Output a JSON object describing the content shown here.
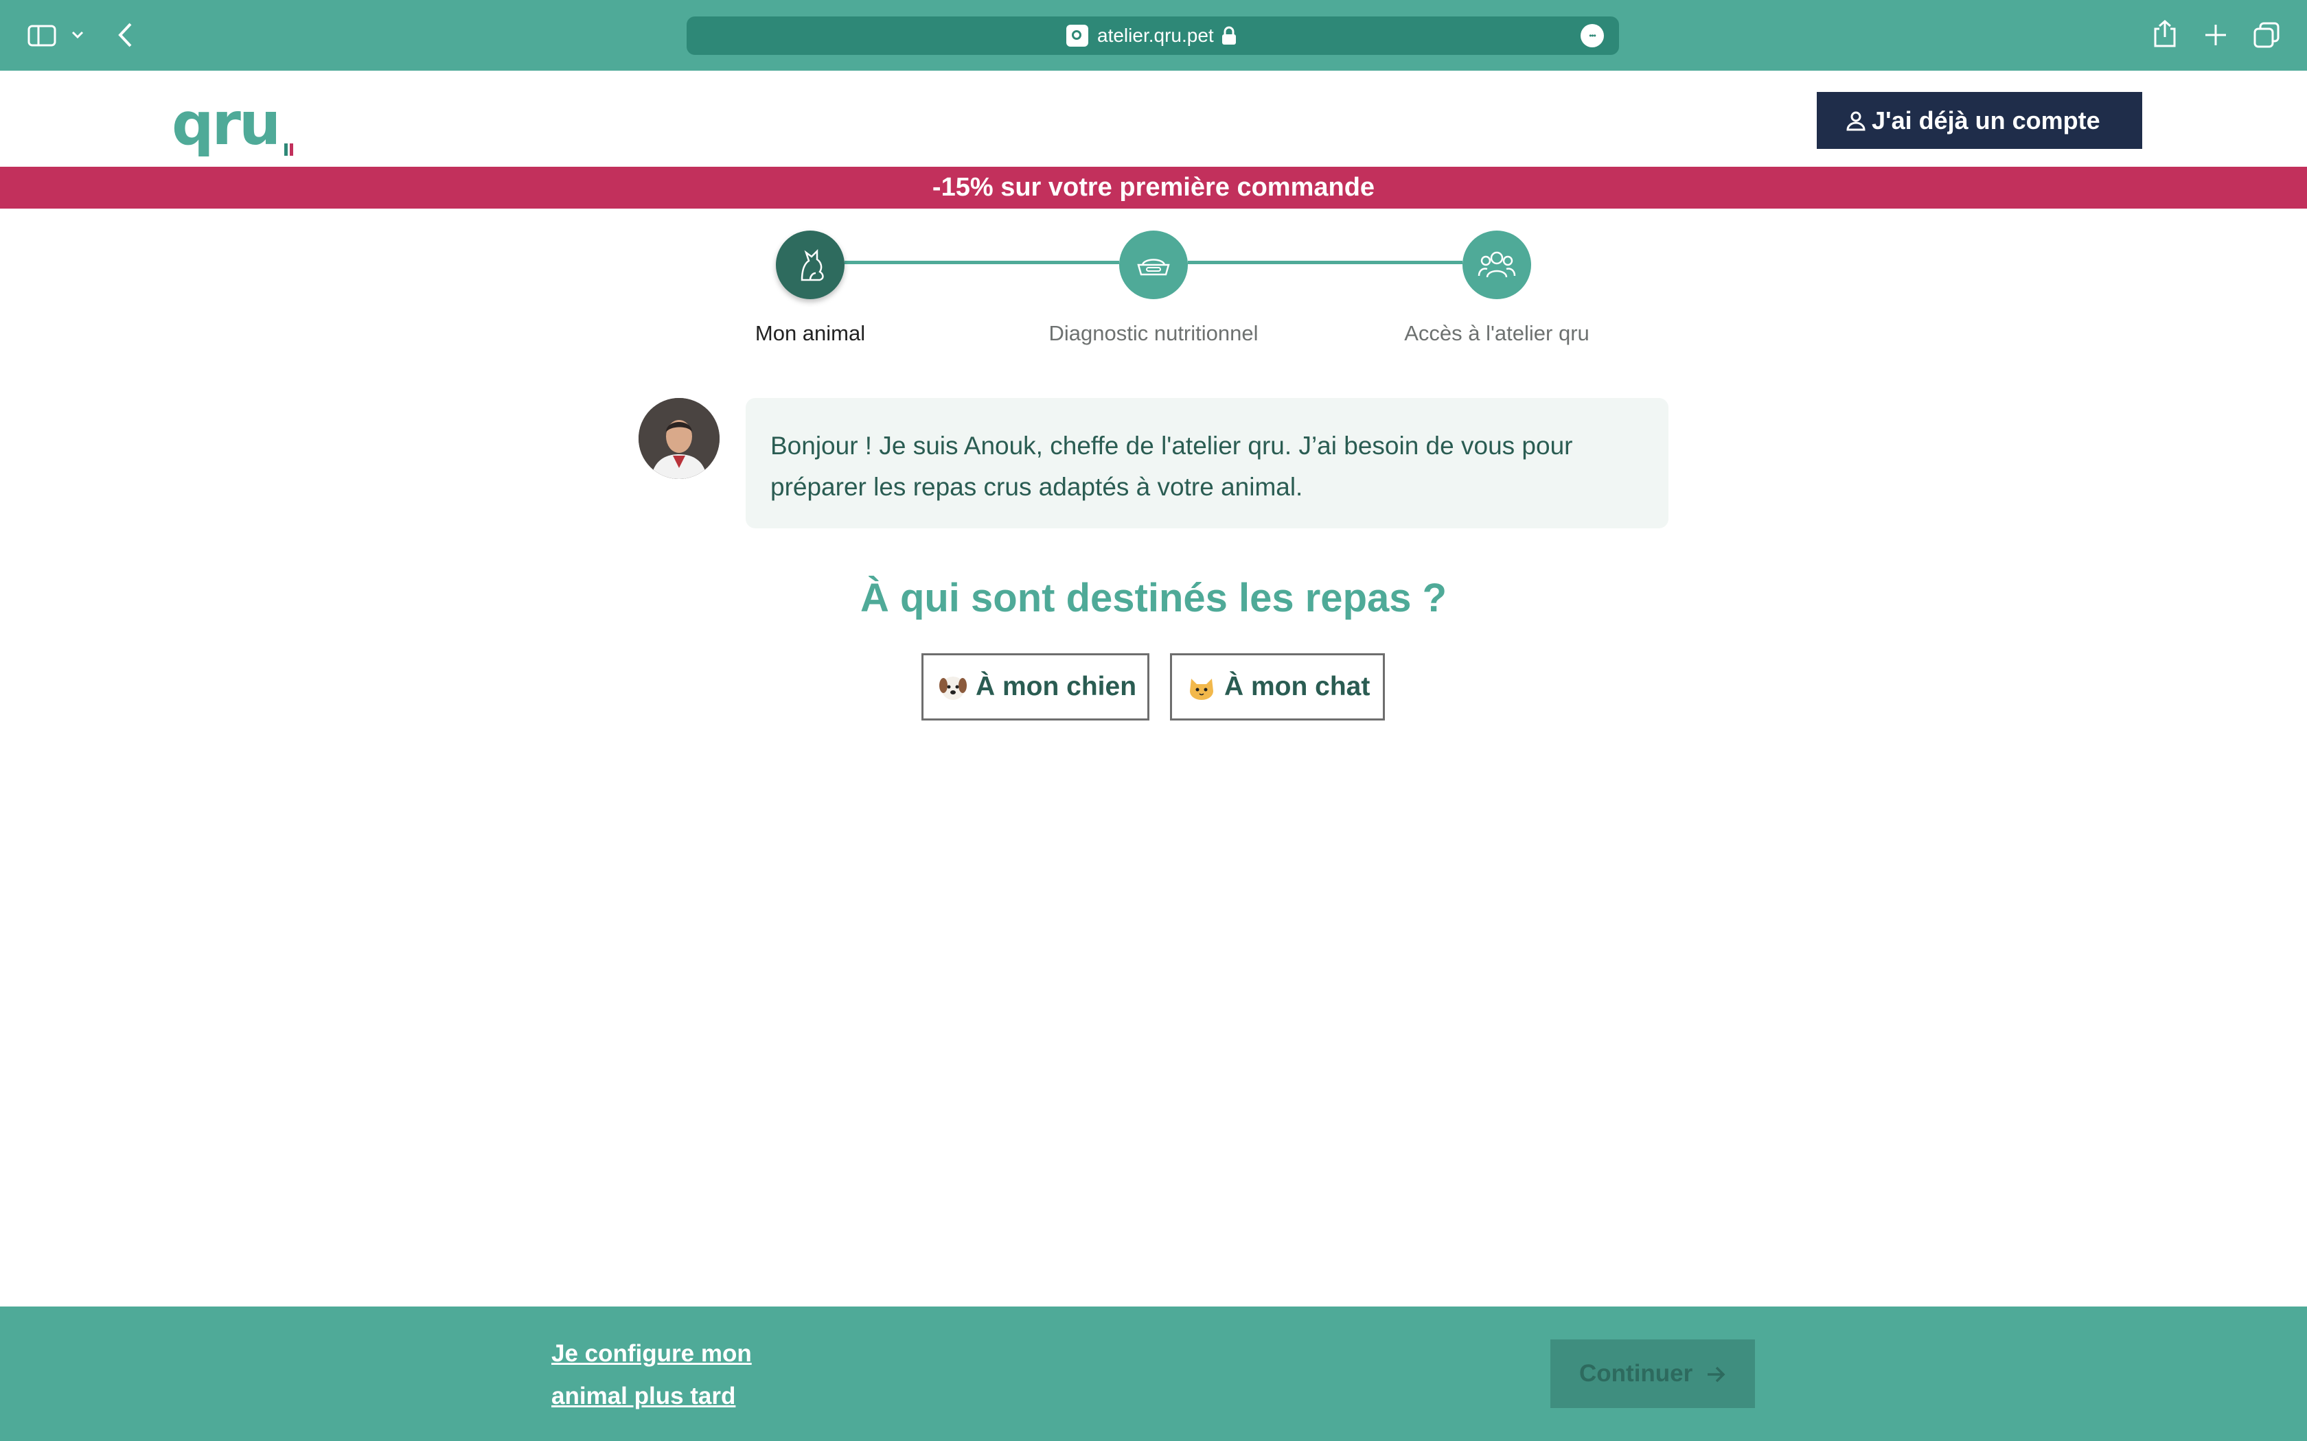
{
  "browser": {
    "url": "atelier.qru.pet",
    "icons": [
      "sidebar-icon",
      "chevron-down-icon",
      "back-icon",
      "site-icon",
      "lock-icon",
      "more-icon",
      "share-icon",
      "new-tab-icon",
      "tabs-icon"
    ]
  },
  "header": {
    "logo": "qru",
    "account_button": "J'ai déjà un compte"
  },
  "promo": {
    "text": "-15% sur votre première commande"
  },
  "steps": [
    {
      "label": "Mon animal",
      "icon": "dog-cat-icon",
      "active": true
    },
    {
      "label": "Diagnostic nutritionnel",
      "icon": "food-bowl-icon",
      "active": false
    },
    {
      "label": "Accès à l'atelier qru",
      "icon": "community-icon",
      "active": false
    }
  ],
  "chat": {
    "message": "Bonjour ! Je suis Anouk, cheffe de l'atelier qru. J’ai besoin de vous pour préparer les repas crus adaptés à votre animal."
  },
  "question": {
    "title": "À qui sont destinés les repas ?",
    "options": [
      {
        "label": "À mon chien",
        "icon": "dog-emoji-icon"
      },
      {
        "label": "À mon chat",
        "icon": "cat-emoji-icon"
      }
    ]
  },
  "footer": {
    "later_link": "Je configure mon animal plus tard",
    "continue_button": "Continuer"
  },
  "colors": {
    "brand_green": "#4faa98",
    "dark_green": "#2e6b5e",
    "promo_red": "#c2305c",
    "navy": "#1f2d4a"
  }
}
